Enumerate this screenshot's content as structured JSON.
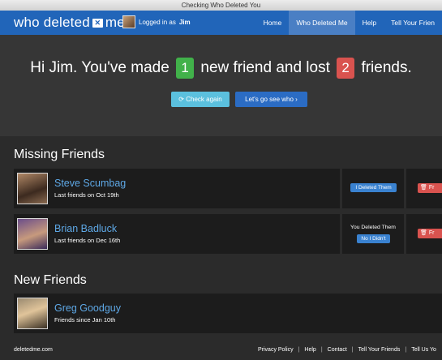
{
  "window": {
    "title": "Checking Who Deleted You"
  },
  "navbar": {
    "brand_left": "who deleted",
    "brand_box": "me",
    "brand_right": "me",
    "login_prefix": "Logged in as",
    "login_user": "Jim",
    "links": [
      "Home",
      "Who Deleted Me",
      "Help",
      "Tell Your Frien"
    ]
  },
  "hero": {
    "greeting": "Hi Jim. You've made",
    "new_count": "1",
    "middle": "new friend and lost",
    "lost_count": "2",
    "end": "friends.",
    "check_again": "Check again",
    "go_see": "Let's go see who"
  },
  "missing": {
    "title": "Missing Friends",
    "friends": [
      {
        "name": "Steve Scumbag",
        "sub": "Last friends on Oct 19th",
        "action_button": "I Deleted Them",
        "delete_label": "Fr"
      },
      {
        "name": "Brian Badluck",
        "sub": "Last friends on Dec 16th",
        "action_text": "You Deleted Them",
        "action_button": "No I Didn't",
        "delete_label": "Fr"
      }
    ]
  },
  "new_friends": {
    "title": "New Friends",
    "friends": [
      {
        "name": "Greg Goodguy",
        "sub": "Friends since Jan 10th"
      }
    ]
  },
  "footer": {
    "site": "deletedme.com",
    "links": [
      "Privacy Policy",
      "Help",
      "Contact",
      "Tell Your Friends",
      "Tell Us Yo"
    ]
  },
  "colors": {
    "navbar": "#2165b9",
    "background": "#2b2b2b",
    "hero": "#363636",
    "card": "#1c1c1c",
    "link": "#5ea8e6",
    "green": "#41b14a",
    "red": "#d9534f",
    "info": "#5bc0de"
  }
}
